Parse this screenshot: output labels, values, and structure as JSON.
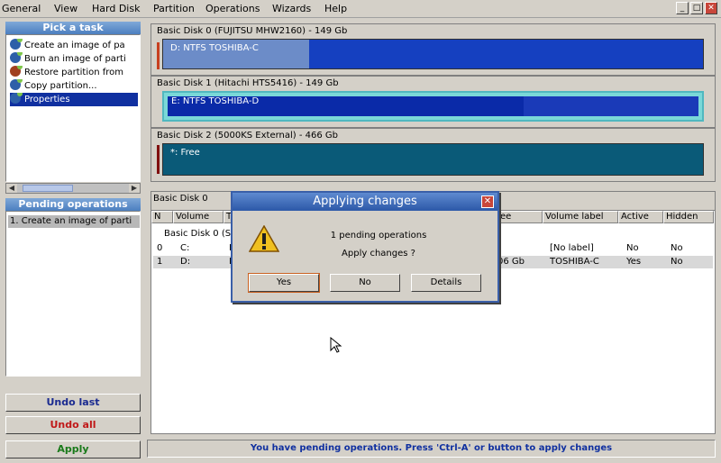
{
  "menu": [
    "General",
    "View",
    "Hard Disk",
    "Partition",
    "Operations",
    "Wizards",
    "Help"
  ],
  "window_buttons": [
    "_",
    "□",
    "✕"
  ],
  "tasks": {
    "title": "Pick a task",
    "items": [
      {
        "label": "Create an image of pa",
        "icon": "image-create-icon"
      },
      {
        "label": "Burn an image of parti",
        "icon": "image-burn-icon"
      },
      {
        "label": "Restore partition from",
        "icon": "restore-icon"
      },
      {
        "label": "Copy partition...",
        "icon": "copy-icon"
      },
      {
        "label": "Properties",
        "icon": "properties-icon"
      }
    ]
  },
  "pending": {
    "title": "Pending operations",
    "items": [
      "1. Create an image of parti"
    ]
  },
  "buttons": {
    "undo_last": "Undo last",
    "undo_all": "Undo all",
    "apply": "Apply"
  },
  "colors": {
    "undo_last": "#1a2a90",
    "undo_all": "#c01818",
    "apply": "#1a7a1a"
  },
  "disks": [
    {
      "label": "Basic Disk 0 (FUJITSU MHW2160) - 149 Gb",
      "partition": "D: NTFS TOSHIBA-C",
      "used_fraction": 0.27
    },
    {
      "label": "Basic Disk 1 (Hitachi HTS5416) - 149 Gb",
      "partition": "E: NTFS TOSHIBA-D",
      "used_fraction": 0.67
    },
    {
      "label": "Basic Disk 2 (5000KS External) - 466 Gb",
      "partition": "*: Free",
      "used_fraction": 0
    }
  ],
  "listview": {
    "header": "Basic Disk 0",
    "columns": [
      "N",
      "Volume",
      "T",
      "ee",
      "Volume label",
      "Active",
      "Hidden"
    ],
    "group": "Basic Disk 0 (S",
    "rows": [
      {
        "n": "0",
        "volume": "C:",
        "t": "I",
        "free": "",
        "label": "[No label]",
        "active": "No",
        "hidden": "No"
      },
      {
        "n": "1",
        "volume": "D:",
        "t": "I",
        "free": "06 Gb",
        "label": "TOSHIBA-C",
        "active": "Yes",
        "hidden": "No"
      }
    ]
  },
  "status": "You have pending operations. Press 'Ctrl-A' or button to apply changes",
  "dialog": {
    "title": "Applying changes",
    "line1": "1 pending operations",
    "line2": "Apply changes ?",
    "yes": "Yes",
    "no": "No",
    "details": "Details"
  }
}
